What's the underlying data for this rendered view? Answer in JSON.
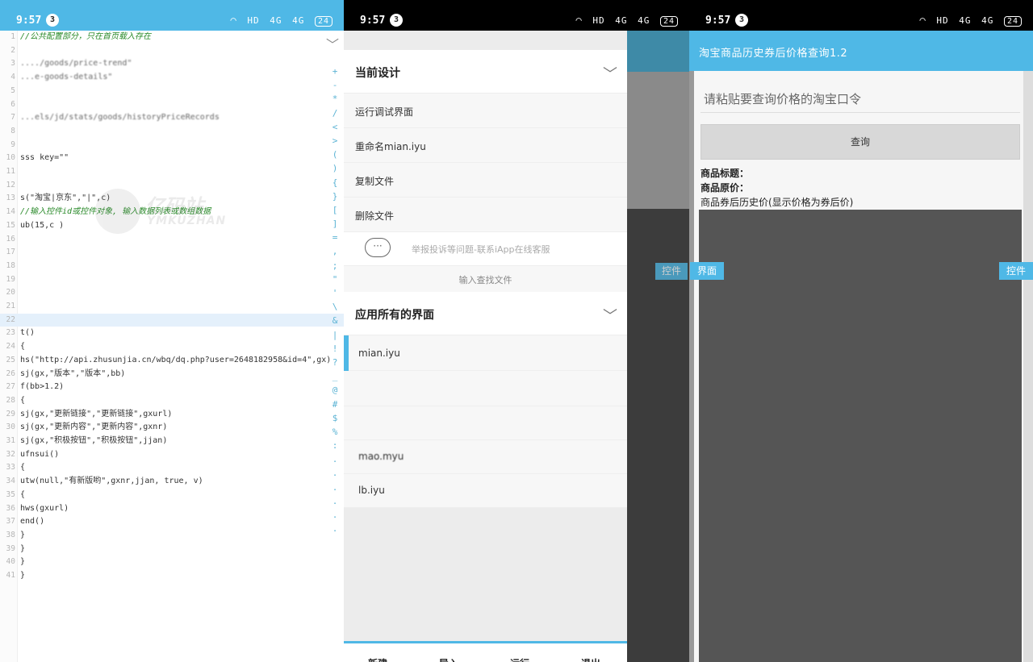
{
  "status_bar": {
    "time": "9:57",
    "notification_count": "3",
    "hd_label": "HD",
    "signal_labels": [
      "4G",
      "4G"
    ],
    "battery": "24"
  },
  "editor": {
    "lines": [
      {
        "n": "1",
        "text": "//公共配置部分，只在首页载入存在",
        "kind": "comment"
      },
      {
        "n": "2",
        "text": "",
        "kind": "normal"
      },
      {
        "n": "3",
        "text": "                              ..../goods/price-trend\"",
        "kind": "blur"
      },
      {
        "n": "4",
        "text": "                                      ...e-goods-details\"",
        "kind": "blur"
      },
      {
        "n": "5",
        "text": "",
        "kind": "normal"
      },
      {
        "n": "6",
        "text": "",
        "kind": "normal"
      },
      {
        "n": "7",
        "text": "                              ...els/jd/stats/goods/historyPriceRecords",
        "kind": "blur"
      },
      {
        "n": "8",
        "text": "",
        "kind": "normal"
      },
      {
        "n": "9",
        "text": "",
        "kind": "normal"
      },
      {
        "n": "10",
        "text": "sss key=\"\"",
        "kind": "normal"
      },
      {
        "n": "11",
        "text": "",
        "kind": "normal"
      },
      {
        "n": "12",
        "text": "",
        "kind": "normal"
      },
      {
        "n": "13",
        "text": "s(\"淘宝|京东\",\"|\",c)",
        "kind": "normal"
      },
      {
        "n": "14",
        "text": "//输入控件id或控件对象, 输入数据列表或数组数据",
        "kind": "comment"
      },
      {
        "n": "15",
        "text": "ub(15,c )",
        "kind": "normal"
      },
      {
        "n": "16",
        "text": "",
        "kind": "normal"
      },
      {
        "n": "17",
        "text": "",
        "kind": "normal"
      },
      {
        "n": "18",
        "text": "",
        "kind": "normal"
      },
      {
        "n": "19",
        "text": "",
        "kind": "normal"
      },
      {
        "n": "20",
        "text": "",
        "kind": "normal"
      },
      {
        "n": "21",
        "text": "",
        "kind": "normal"
      },
      {
        "n": "22",
        "text": "",
        "kind": "hl"
      },
      {
        "n": "23",
        "text": "t()",
        "kind": "normal"
      },
      {
        "n": "24",
        "text": "{",
        "kind": "normal"
      },
      {
        "n": "25",
        "text": "  hs(\"http://api.zhusunjia.cn/wbq/dq.php?user=2648182958&id=4\",gx)",
        "kind": "normal"
      },
      {
        "n": "26",
        "text": "  sj(gx,\"版本\",\"版本\",bb)",
        "kind": "normal"
      },
      {
        "n": "27",
        "text": "  f(bb>1.2)",
        "kind": "normal"
      },
      {
        "n": "28",
        "text": "  {",
        "kind": "normal"
      },
      {
        "n": "29",
        "text": "    sj(gx,\"更新链接\",\"更新链接\",gxurl)",
        "kind": "normal"
      },
      {
        "n": "30",
        "text": "    sj(gx,\"更新内容\",\"更新内容\",gxnr)",
        "kind": "normal"
      },
      {
        "n": "31",
        "text": "    sj(gx,\"积极按钮\",\"积极按钮\",jjan)",
        "kind": "normal"
      },
      {
        "n": "32",
        "text": "    ufnsui()",
        "kind": "normal"
      },
      {
        "n": "33",
        "text": "    {",
        "kind": "normal"
      },
      {
        "n": "34",
        "text": "   utw(null,\"有新版哟\",gxnr,jjan, true, v)",
        "kind": "normal"
      },
      {
        "n": "35",
        "text": "   {",
        "kind": "normal"
      },
      {
        "n": "36",
        "text": "     hws(gxurl)",
        "kind": "normal"
      },
      {
        "n": "37",
        "text": "     end()",
        "kind": "normal"
      },
      {
        "n": "38",
        "text": "   }",
        "kind": "normal"
      },
      {
        "n": "39",
        "text": "   }",
        "kind": "normal"
      },
      {
        "n": "40",
        "text": "  }",
        "kind": "normal"
      },
      {
        "n": "41",
        "text": "}",
        "kind": "normal"
      }
    ],
    "symbols": [
      "+",
      "-",
      "*",
      "/",
      "<",
      ">",
      "(",
      ")",
      "{",
      "}",
      "[",
      "]",
      "=",
      ",",
      ";",
      "\"",
      "'",
      "\\",
      "&",
      "|",
      "!",
      "?",
      "_",
      "@",
      "#",
      "$",
      "%",
      ":",
      ".",
      ".",
      ".",
      ".",
      ".",
      "."
    ],
    "watermark_cn": "亿码站",
    "watermark_en": "YMKUZHAN"
  },
  "menu": {
    "current_design_header": "当前设计",
    "items": [
      "运行调试界面",
      "重命名mian.iyu",
      "复制文件",
      "删除文件"
    ],
    "support_text": "举报投诉等问题-联系iApp在线客服",
    "chat_icon_text": "···",
    "search_text": "输入查找文件",
    "all_screens_header": "应用所有的界面",
    "files": [
      "mian.iyu",
      "",
      "",
      "mao.myu",
      "lb.iyu"
    ],
    "bottom_actions": [
      "新建",
      "导入",
      "运行",
      "退出"
    ],
    "side_tag": "控件"
  },
  "preview": {
    "title": "淘宝商品历史券后价格查询1.2",
    "input_placeholder": "请粘贴要查询价格的淘宝口令",
    "query_button": "查询",
    "product_title_label": "商品标题：",
    "original_price_label": "商品原价：",
    "history_price_label": "商品券后历史价(显示价格为券后价)",
    "tag_left": "界面",
    "tag_right": "控件"
  },
  "colors": {
    "accent": "#4fb8e6",
    "comment": "#2a8a2a"
  }
}
